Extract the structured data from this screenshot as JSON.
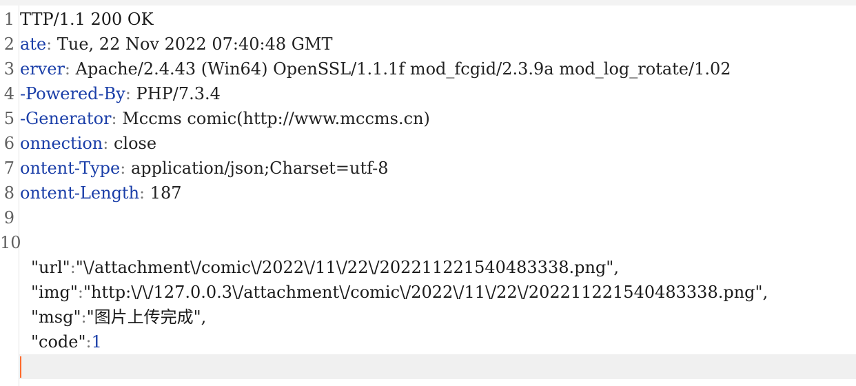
{
  "line_numbers": [
    "1",
    "2",
    "3",
    "4",
    "5",
    "6",
    "7",
    "8",
    "9",
    "10"
  ],
  "status_line": "TTP/1.1 200 OK",
  "headers": [
    {
      "key": "ate",
      "value": "Tue, 22 Nov 2022 07:40:48 GMT"
    },
    {
      "key": "erver",
      "value": "Apache/2.4.43 (Win64) OpenSSL/1.1.1f mod_fcgid/2.3.9a mod_log_rotate/1.02"
    },
    {
      "key": "-Powered-By",
      "value": "PHP/7.3.4"
    },
    {
      "key": "-Generator",
      "value": "Mccms comic(http://www.mccms.cn)"
    },
    {
      "key": "onnection",
      "value": "close"
    },
    {
      "key": "ontent-Type",
      "value": "application/json;Charset=utf-8"
    },
    {
      "key": "ontent-Length",
      "value": "187"
    }
  ],
  "json_body": [
    {
      "key": "\"url\"",
      "value": "\"\\/attachment\\/comic\\/2022\\/11\\/22\\/202211221540483338.png\","
    },
    {
      "key": "\"img\"",
      "value": "\"http:\\/\\/127.0.0.3\\/attachment\\/comic\\/2022\\/11\\/22\\/202211221540483338.png\","
    },
    {
      "key": "\"msg\"",
      "value": "\"图片上传完成\","
    },
    {
      "key": "\"code\"",
      "value": "1"
    }
  ],
  "colors": {
    "key": "#1a3ea8",
    "caret": "#ff6a2c",
    "current_line": "#f0f0f0"
  }
}
